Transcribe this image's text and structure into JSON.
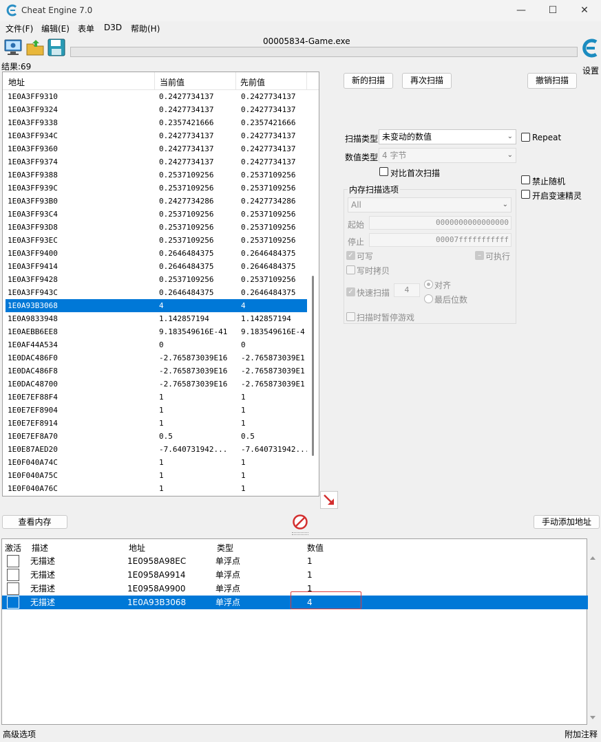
{
  "window": {
    "title": "Cheat Engine 7.0",
    "controls": [
      "—",
      "☐",
      "✕"
    ]
  },
  "menu": [
    "文件(F)",
    "编辑(E)",
    "表单",
    "D3D",
    "帮助(H)"
  ],
  "toolbar": {
    "process_name": "00005834-Game.exe",
    "settings_label": "设置",
    "results_label": "结果:69"
  },
  "scan_results": {
    "columns": [
      "地址",
      "当前值",
      "先前值"
    ],
    "rows": [
      {
        "address": "1E0A3FF9310",
        "current": "0.2427734137",
        "previous": "0.2427734137"
      },
      {
        "address": "1E0A3FF9324",
        "current": "0.2427734137",
        "previous": "0.2427734137"
      },
      {
        "address": "1E0A3FF9338",
        "current": "0.2357421666",
        "previous": "0.2357421666"
      },
      {
        "address": "1E0A3FF934C",
        "current": "0.2427734137",
        "previous": "0.2427734137"
      },
      {
        "address": "1E0A3FF9360",
        "current": "0.2427734137",
        "previous": "0.2427734137"
      },
      {
        "address": "1E0A3FF9374",
        "current": "0.2427734137",
        "previous": "0.2427734137"
      },
      {
        "address": "1E0A3FF9388",
        "current": "0.2537109256",
        "previous": "0.2537109256"
      },
      {
        "address": "1E0A3FF939C",
        "current": "0.2537109256",
        "previous": "0.2537109256"
      },
      {
        "address": "1E0A3FF93B0",
        "current": "0.2427734286",
        "previous": "0.2427734286"
      },
      {
        "address": "1E0A3FF93C4",
        "current": "0.2537109256",
        "previous": "0.2537109256"
      },
      {
        "address": "1E0A3FF93D8",
        "current": "0.2537109256",
        "previous": "0.2537109256"
      },
      {
        "address": "1E0A3FF93EC",
        "current": "0.2537109256",
        "previous": "0.2537109256"
      },
      {
        "address": "1E0A3FF9400",
        "current": "0.2646484375",
        "previous": "0.2646484375"
      },
      {
        "address": "1E0A3FF9414",
        "current": "0.2646484375",
        "previous": "0.2646484375"
      },
      {
        "address": "1E0A3FF9428",
        "current": "0.2537109256",
        "previous": "0.2537109256"
      },
      {
        "address": "1E0A3FF943C",
        "current": "0.2646484375",
        "previous": "0.2646484375"
      },
      {
        "address": "1E0A93B3068",
        "current": "4",
        "previous": "4",
        "selected": true
      },
      {
        "address": "1E0A9833948",
        "current": "1.142857194",
        "previous": "1.142857194"
      },
      {
        "address": "1E0AEBB6EE8",
        "current": "9.183549616E-41",
        "previous": "9.183549616E-4"
      },
      {
        "address": "1E0AF44A534",
        "current": "0",
        "previous": "0"
      },
      {
        "address": "1E0DAC486F0",
        "current": "-2.765873039E16",
        "previous": "-2.765873039E1"
      },
      {
        "address": "1E0DAC486F8",
        "current": "-2.765873039E16",
        "previous": "-2.765873039E1"
      },
      {
        "address": "1E0DAC48700",
        "current": "-2.765873039E16",
        "previous": "-2.765873039E1"
      },
      {
        "address": "1E0E7EF88F4",
        "current": "1",
        "previous": "1"
      },
      {
        "address": "1E0E7EF8904",
        "current": "1",
        "previous": "1"
      },
      {
        "address": "1E0E7EF8914",
        "current": "1",
        "previous": "1"
      },
      {
        "address": "1E0E7EF8A70",
        "current": "0.5",
        "previous": "0.5"
      },
      {
        "address": "1E0E87AED20",
        "current": "-7.640731942...",
        "previous": "-7.640731942..."
      },
      {
        "address": "1E0F040A74C",
        "current": "1",
        "previous": "1"
      },
      {
        "address": "1E0F040A75C",
        "current": "1",
        "previous": "1"
      },
      {
        "address": "1E0F040A76C",
        "current": "1",
        "previous": "1"
      }
    ]
  },
  "scan_panel": {
    "new_scan": "新的扫描",
    "next_scan": "再次扫描",
    "undo_scan": "撤销扫描",
    "scan_type_label": "扫描类型",
    "scan_type_value": "未变动的数值",
    "value_type_label": "数值类型",
    "value_type_value": "4 字节",
    "compare_first": "对比首次扫描",
    "repeat": "Repeat",
    "no_random": "禁止随机",
    "speedhack": "开启变速精灵",
    "mem_options_title": "内存扫描选项",
    "mem_region": "All",
    "start_label": "起始",
    "start_value": "0000000000000000",
    "stop_label": "停止",
    "stop_value": "00007fffffffffff",
    "writable": "可写",
    "executable": "可执行",
    "copy_on_write": "写时拷贝",
    "fast_scan": "快速扫描",
    "fast_scan_value": "4",
    "align": "对齐",
    "last_digits": "最后位数",
    "pause_game": "扫描时暂停游戏"
  },
  "actions": {
    "view_memory": "查看内存",
    "add_address": "手动添加地址"
  },
  "address_table": {
    "columns": [
      "激活",
      "描述",
      "地址",
      "类型",
      "数值"
    ],
    "rows": [
      {
        "description": "无描述",
        "address": "1E0958A98EC",
        "type": "单浮点",
        "value": "1"
      },
      {
        "description": "无描述",
        "address": "1E0958A9914",
        "type": "单浮点",
        "value": "1"
      },
      {
        "description": "无描述",
        "address": "1E0958A9900",
        "type": "单浮点",
        "value": "1"
      },
      {
        "description": "无描述",
        "address": "1E0A93B3068",
        "type": "单浮点",
        "value": "4",
        "selected": true
      }
    ]
  },
  "status": {
    "advanced": "高级选项",
    "comments": "附加注释"
  },
  "colors": {
    "selection": "#0078d7",
    "highlight": "#e03c3c"
  }
}
